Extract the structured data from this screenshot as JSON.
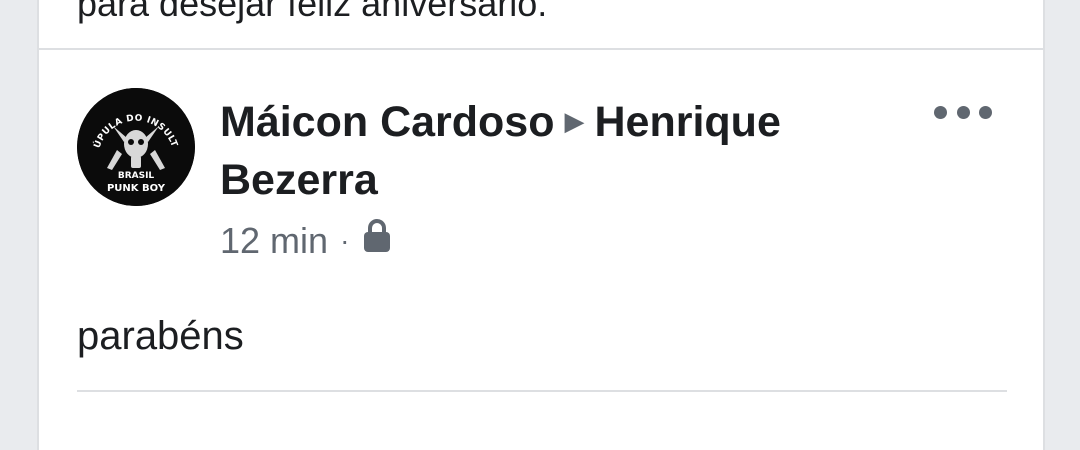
{
  "previous_post": {
    "text": "para desejar feliz aniversário."
  },
  "post": {
    "avatar": {
      "top_text": "CÚPULA DO INSULTO",
      "line1": "BRASIL",
      "line2": "PUNK BOY"
    },
    "author": "Máicon Cardoso",
    "arrow": "▶",
    "target": "Henrique Bezerra",
    "time": "12 min",
    "separator": "·",
    "privacy_icon": "lock-icon",
    "more_icon": "more-options-icon",
    "body": "parabéns"
  },
  "colors": {
    "text_primary": "#1c1e21",
    "text_secondary": "#606770",
    "divider": "#dddfe2"
  }
}
